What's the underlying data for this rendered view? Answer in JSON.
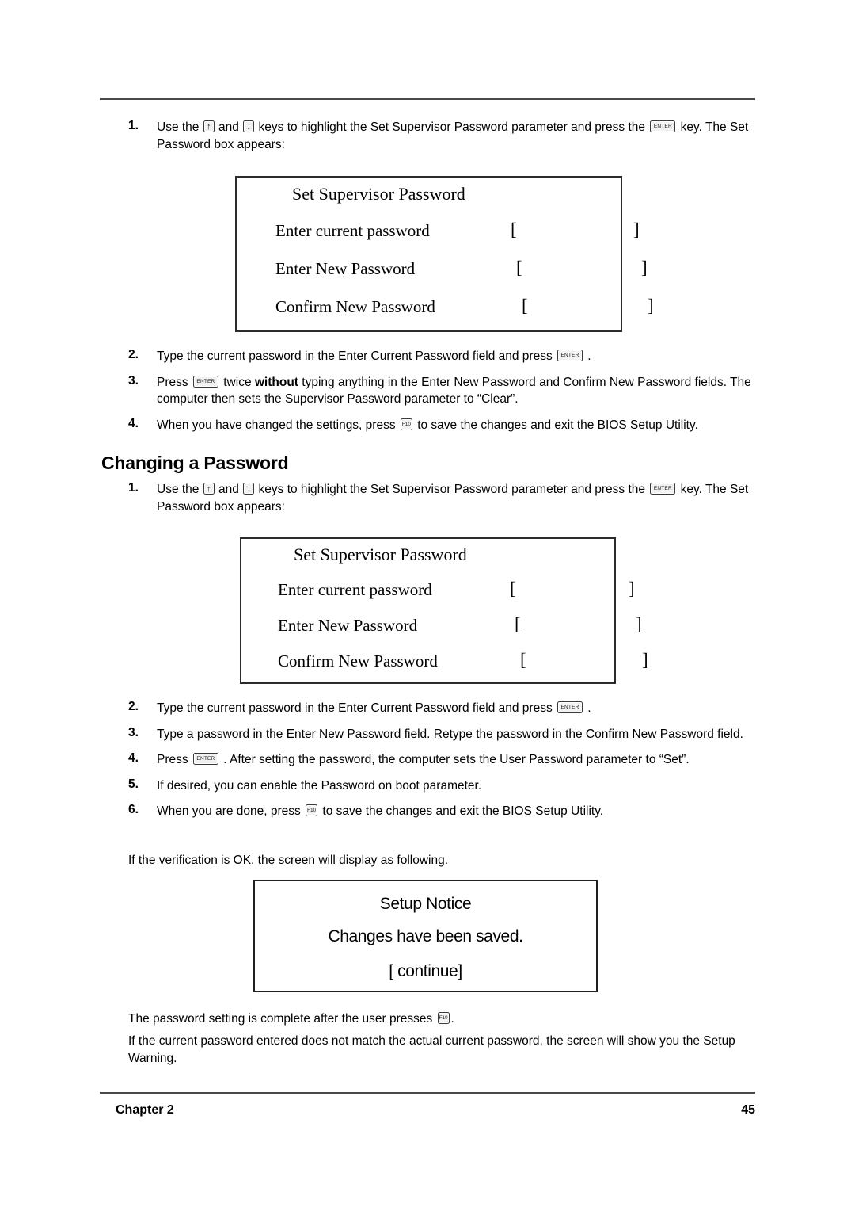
{
  "page": {
    "footer_chapter": "Chapter 2",
    "footer_page_number": "45"
  },
  "section_one": {
    "steps": [
      {
        "number": "1.",
        "text_a": "Use the ",
        "key_up": "↑",
        "text_b": " and ",
        "key_down": "↓",
        "text_c": " keys to highlight the Set Supervisor Password parameter and press the ",
        "key_enter": "ENTER",
        "text_d": " key. The Set Password box appears:"
      },
      {
        "number": "2.",
        "text_a": "Type the current password in the Enter Current Password field and press ",
        "key_enter": "ENTER",
        "text_b": " ."
      },
      {
        "number": "3.",
        "text_a": "Press ",
        "key_enter": "ENTER",
        "text_b": " twice ",
        "bold": "without",
        "text_c": " typing anything in the Enter New Password and Confirm New Password fields. The computer then sets the Supervisor Password parameter to “Clear”."
      },
      {
        "number": "4.",
        "text_a": "When you have changed the settings, press ",
        "key_f10": "F10",
        "text_b": " to save the changes and exit the BIOS Setup Utility."
      }
    ]
  },
  "heading": {
    "changing_a_password": "Changing a Password"
  },
  "section_two": {
    "steps": [
      {
        "number": "1.",
        "text_a": "Use the ",
        "key_up": "↑",
        "text_b": " and ",
        "key_down": "↓",
        "text_c": " keys to highlight the Set Supervisor Password parameter and press the ",
        "key_enter": "ENTER",
        "text_d": " key. The Set Password box appears:"
      },
      {
        "number": "2.",
        "text_a": "Type the current password in the Enter Current Password field and press ",
        "key_enter": "ENTER",
        "text_b": " ."
      },
      {
        "number": "3.",
        "text_a": "Type a password in the Enter New Password field. Retype the password in the Confirm New Password field."
      },
      {
        "number": "4.",
        "text_a": "Press ",
        "key_enter": "ENTER",
        "text_b": " . After setting the password, the computer sets the User Password parameter to “Set”."
      },
      {
        "number": "5.",
        "text_a": "If desired, you can enable the Password on boot parameter."
      },
      {
        "number": "6.",
        "text_a": "When you are done, press ",
        "key_f10": "F10",
        "text_b": " to save the changes and exit the BIOS Setup Utility."
      }
    ]
  },
  "password_dialog": {
    "title": "Set Supervisor Password",
    "rows": [
      {
        "label": "Enter current password",
        "open_bracket": "[",
        "close_bracket": "]",
        "value": ""
      },
      {
        "label": "Enter New Password",
        "open_bracket": "[",
        "close_bracket": "]",
        "value": ""
      },
      {
        "label": "Confirm New Password",
        "open_bracket": "[",
        "close_bracket": "]",
        "value": ""
      }
    ]
  },
  "setup_notice": {
    "title": "Setup Notice",
    "message": "Changes have been saved.",
    "button": "[ continue]"
  },
  "paragraphs": {
    "verification_ok": "If the verification is OK, the screen will display as following.",
    "complete_a": "The password setting is complete after the user presses ",
    "complete_key": "F10",
    "complete_b": ".",
    "mismatch": "If the current password entered does not match the actual current password, the screen will show you the Setup Warning."
  }
}
